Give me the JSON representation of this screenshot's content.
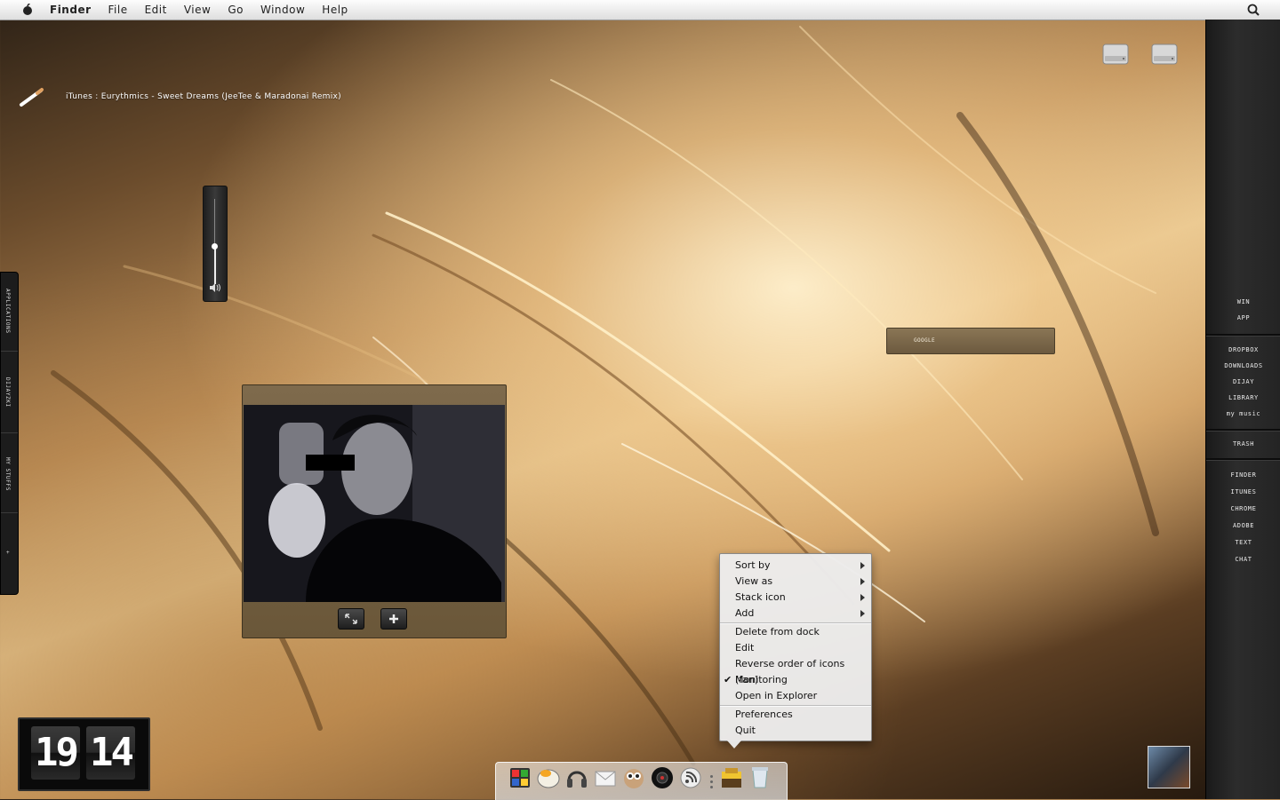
{
  "menubar": {
    "items": [
      "Finder",
      "File",
      "Edit",
      "View",
      "Go",
      "Window",
      "Help"
    ]
  },
  "now_playing": {
    "text": "iTunes : Eurythmics - Sweet Dreams (JeeTee & Maradonai Remix)"
  },
  "right_sidebar": {
    "group1": [
      "WIN",
      "APP"
    ],
    "group2": [
      "DROPBOX",
      "DOWNLOADS",
      "DIJAY",
      "LIBRARY",
      "my music"
    ],
    "group3": [
      "TRASH"
    ],
    "group4": [
      "FINDER",
      "ITUNES",
      "CHROME",
      "ADOBE",
      "TEXT",
      "CHAT"
    ]
  },
  "left_tabs": {
    "items": [
      "APPLICATIONS",
      "DIJAYZKI",
      "MY STUFFS",
      "+"
    ]
  },
  "volume": {
    "level": 0.45
  },
  "google_bar": {
    "label": "GOOGLE"
  },
  "clock": {
    "hours": "19",
    "minutes": "14"
  },
  "context_menu": {
    "items": [
      {
        "label": "Sort by",
        "submenu": true
      },
      {
        "label": "View as",
        "submenu": true
      },
      {
        "label": "Stack icon",
        "submenu": true
      },
      {
        "label": "Add",
        "submenu": true
      },
      {
        "label": "Delete from dock",
        "submenu": false
      },
      {
        "label": "Edit",
        "submenu": false
      },
      {
        "label": "Reverse order of icons (fan)",
        "submenu": false
      },
      {
        "label": "Monitoring",
        "submenu": false,
        "checked": true
      },
      {
        "label": "Open in Explorer",
        "submenu": false
      },
      {
        "label": "Preferences",
        "submenu": false
      },
      {
        "label": "Quit",
        "submenu": false
      }
    ]
  },
  "dock": {
    "icons": [
      "dashboard-icon",
      "itunes-icon",
      "headphones-icon",
      "mail-icon",
      "owl-icon",
      "camera-icon",
      "rss-icon",
      "stack-icon",
      "trash-icon"
    ]
  },
  "icons": {
    "apple": "apple-icon",
    "spotlight": "spotlight-icon",
    "drive": "hard-drive-icon",
    "fullscreen": "fullscreen-icon",
    "add": "plus-icon"
  },
  "colors": {
    "menubar": "#e8e8e8",
    "sidebar": "#262626",
    "widget": "#75623f",
    "context_menu": "#ececec"
  }
}
